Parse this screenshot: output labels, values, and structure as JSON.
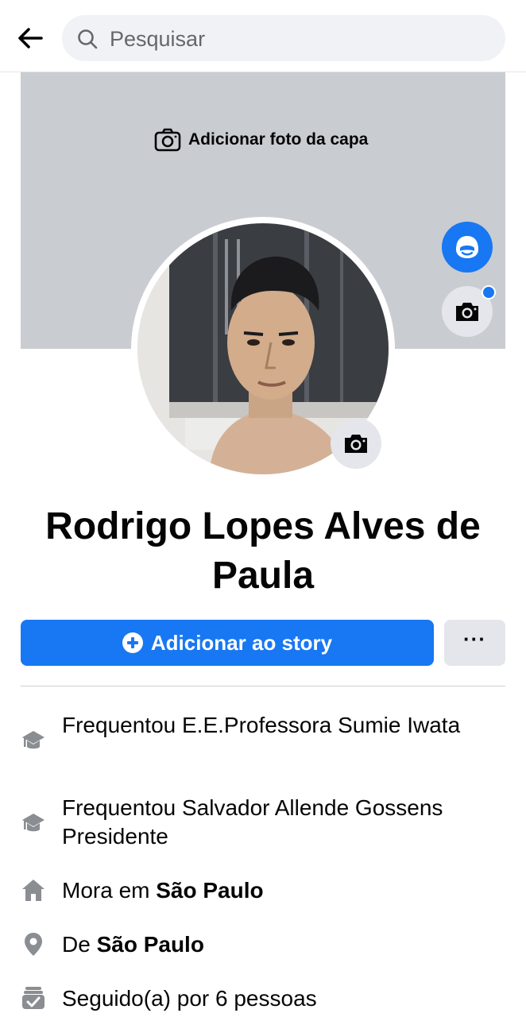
{
  "search": {
    "placeholder": "Pesquisar"
  },
  "cover": {
    "add_label": "Adicionar foto da capa"
  },
  "profile": {
    "name": "Rodrigo Lopes Alves de Paula"
  },
  "actions": {
    "story_label": "Adicionar ao story",
    "more_label": "···"
  },
  "details": {
    "school1": "Frequentou E.E.Professora Sumie Iwata",
    "school2": "Frequentou Salvador Allende Gossens Presidente",
    "lives_prefix": "Mora em",
    "lives_city": "São Paulo",
    "from_prefix": "De",
    "from_city": "São Paulo",
    "followers": "Seguido(a) por 6 pessoas"
  },
  "colors": {
    "accent": "#1877f2",
    "cover_bg": "#c9ccd1",
    "secondary_btn": "#e4e6eb",
    "icon_gray": "#8a8d91"
  }
}
